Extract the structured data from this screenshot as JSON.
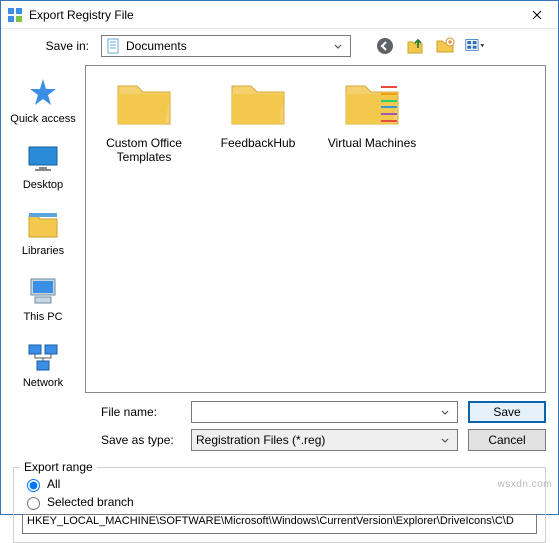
{
  "title": "Export Registry File",
  "savein": {
    "label": "Save in:",
    "value": "Documents"
  },
  "sidebar": [
    {
      "id": "quick-access",
      "label": "Quick access"
    },
    {
      "id": "desktop",
      "label": "Desktop"
    },
    {
      "id": "libraries",
      "label": "Libraries"
    },
    {
      "id": "this-pc",
      "label": "This PC"
    },
    {
      "id": "network",
      "label": "Network"
    }
  ],
  "folders": [
    {
      "id": "custom-office",
      "label": "Custom Office Templates"
    },
    {
      "id": "feedbackhub",
      "label": "FeedbackHub"
    },
    {
      "id": "virtual-machines",
      "label": "Virtual Machines"
    }
  ],
  "filename": {
    "label": "File name:",
    "value": ""
  },
  "saveastype": {
    "label": "Save as type:",
    "value": "Registration Files (*.reg)"
  },
  "buttons": {
    "save": "Save",
    "cancel": "Cancel"
  },
  "export": {
    "legend": "Export range",
    "all": "All",
    "branch": "Selected branch",
    "path": "HKEY_LOCAL_MACHINE\\SOFTWARE\\Microsoft\\Windows\\CurrentVersion\\Explorer\\DriveIcons\\C\\D"
  },
  "watermark": "wsxdn.com"
}
